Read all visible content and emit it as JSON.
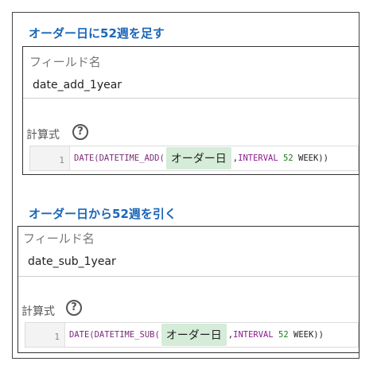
{
  "section1": {
    "title": "オーダー日に52週を足す",
    "field_label": "フィールド名",
    "field_value": "date_add_1year",
    "calc_label": "計算式",
    "help": "?",
    "line_no": "1",
    "code": {
      "fn": "DATE(DATETIME_ADD(",
      "chip": "オーダー日",
      "comma": ",",
      "kw": "INTERVAL",
      "num": "52",
      "tail": "WEEK))"
    }
  },
  "section2": {
    "title": "オーダー日から52週を引く",
    "field_label": "フィールド名",
    "field_value": "date_sub_1year",
    "calc_label": "計算式",
    "help": "?",
    "line_no": "1",
    "code": {
      "fn": "DATE(DATETIME_SUB(",
      "chip": "オーダー日",
      "comma": ",",
      "kw": "INTERVAL",
      "num": "52",
      "tail": "WEEK))"
    }
  },
  "colors": {
    "title": "#1a66b8",
    "chip_bg": "#d4ecd8",
    "function": "#7a2a7a",
    "number": "#1a7a1a"
  }
}
